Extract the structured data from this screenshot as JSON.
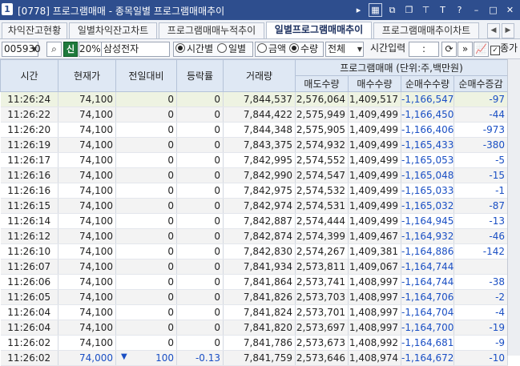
{
  "window": {
    "number": "1",
    "title": "[0778] 프로그램매매 - 종목일별 프로그램매매추이"
  },
  "titlebar_icons": [
    "caret-right-icon",
    "grid-icon",
    "copy-icon",
    "window-icon",
    "pin-icon",
    "font-icon",
    "help-icon",
    "minimize-icon",
    "restore-icon",
    "close-icon"
  ],
  "tabs": [
    {
      "label": "차익잔고현황",
      "active": false
    },
    {
      "label": "일별차익잔고차트",
      "active": false
    },
    {
      "label": "프로그램매매누적추이",
      "active": false
    },
    {
      "label": "일별프로그램매매추이",
      "active": true
    },
    {
      "label": "프로그램매매추이차트",
      "active": false
    }
  ],
  "toolbar": {
    "code": "005930",
    "badge": "신",
    "margin": "20%",
    "stock_name": "삼성전자",
    "period_options": [
      {
        "label": "시간별",
        "selected": true
      },
      {
        "label": "일별",
        "selected": false
      }
    ],
    "unit_options": [
      {
        "label": "금액",
        "selected": false
      },
      {
        "label": "수량",
        "selected": true
      }
    ],
    "scope": "전체",
    "time_label": "시간입력",
    "time_value": ":",
    "include_label": "종가",
    "include_checked": true
  },
  "grid": {
    "headers": {
      "time": "시간",
      "price": "현재가",
      "change": "전일대비",
      "rate": "등락률",
      "volume": "거래량",
      "program_group": "프로그램매매 (단위:주,백만원)",
      "sell": "매도수량",
      "buy": "매수수량",
      "net": "순매수수량",
      "net_delta": "순매수증감"
    },
    "rows": [
      {
        "time": "11:26:24",
        "price": "74,100",
        "change": "0",
        "rate": "0",
        "volume": "7,844,537",
        "sell": "2,576,064",
        "buy": "1,409,517",
        "net": "-1,166,547",
        "delta": "-97"
      },
      {
        "time": "11:26:22",
        "price": "74,100",
        "change": "0",
        "rate": "0",
        "volume": "7,844,422",
        "sell": "2,575,949",
        "buy": "1,409,499",
        "net": "-1,166,450",
        "delta": "-44"
      },
      {
        "time": "11:26:20",
        "price": "74,100",
        "change": "0",
        "rate": "0",
        "volume": "7,844,348",
        "sell": "2,575,905",
        "buy": "1,409,499",
        "net": "-1,166,406",
        "delta": "-973"
      },
      {
        "time": "11:26:19",
        "price": "74,100",
        "change": "0",
        "rate": "0",
        "volume": "7,843,375",
        "sell": "2,574,932",
        "buy": "1,409,499",
        "net": "-1,165,433",
        "delta": "-380"
      },
      {
        "time": "11:26:17",
        "price": "74,100",
        "change": "0",
        "rate": "0",
        "volume": "7,842,995",
        "sell": "2,574,552",
        "buy": "1,409,499",
        "net": "-1,165,053",
        "delta": "-5"
      },
      {
        "time": "11:26:16",
        "price": "74,100",
        "change": "0",
        "rate": "0",
        "volume": "7,842,990",
        "sell": "2,574,547",
        "buy": "1,409,499",
        "net": "-1,165,048",
        "delta": "-15"
      },
      {
        "time": "11:26:16",
        "price": "74,100",
        "change": "0",
        "rate": "0",
        "volume": "7,842,975",
        "sell": "2,574,532",
        "buy": "1,409,499",
        "net": "-1,165,033",
        "delta": "-1"
      },
      {
        "time": "11:26:15",
        "price": "74,100",
        "change": "0",
        "rate": "0",
        "volume": "7,842,974",
        "sell": "2,574,531",
        "buy": "1,409,499",
        "net": "-1,165,032",
        "delta": "-87"
      },
      {
        "time": "11:26:14",
        "price": "74,100",
        "change": "0",
        "rate": "0",
        "volume": "7,842,887",
        "sell": "2,574,444",
        "buy": "1,409,499",
        "net": "-1,164,945",
        "delta": "-13"
      },
      {
        "time": "11:26:12",
        "price": "74,100",
        "change": "0",
        "rate": "0",
        "volume": "7,842,874",
        "sell": "2,574,399",
        "buy": "1,409,467",
        "net": "-1,164,932",
        "delta": "-46"
      },
      {
        "time": "11:26:10",
        "price": "74,100",
        "change": "0",
        "rate": "0",
        "volume": "7,842,830",
        "sell": "2,574,267",
        "buy": "1,409,381",
        "net": "-1,164,886",
        "delta": "-142"
      },
      {
        "time": "11:26:07",
        "price": "74,100",
        "change": "0",
        "rate": "0",
        "volume": "7,841,934",
        "sell": "2,573,811",
        "buy": "1,409,067",
        "net": "-1,164,744",
        "delta": ""
      },
      {
        "time": "11:26:06",
        "price": "74,100",
        "change": "0",
        "rate": "0",
        "volume": "7,841,864",
        "sell": "2,573,741",
        "buy": "1,408,997",
        "net": "-1,164,744",
        "delta": "-38"
      },
      {
        "time": "11:26:05",
        "price": "74,100",
        "change": "0",
        "rate": "0",
        "volume": "7,841,826",
        "sell": "2,573,703",
        "buy": "1,408,997",
        "net": "-1,164,706",
        "delta": "-2"
      },
      {
        "time": "11:26:04",
        "price": "74,100",
        "change": "0",
        "rate": "0",
        "volume": "7,841,824",
        "sell": "2,573,701",
        "buy": "1,408,997",
        "net": "-1,164,704",
        "delta": "-4"
      },
      {
        "time": "11:26:04",
        "price": "74,100",
        "change": "0",
        "rate": "0",
        "volume": "7,841,820",
        "sell": "2,573,697",
        "buy": "1,408,997",
        "net": "-1,164,700",
        "delta": "-19"
      },
      {
        "time": "11:26:02",
        "price": "74,100",
        "change": "0",
        "rate": "0",
        "volume": "7,841,786",
        "sell": "2,573,673",
        "buy": "1,408,992",
        "net": "-1,164,681",
        "delta": "-9"
      },
      {
        "time": "11:26:02",
        "price": "74,000",
        "change": "100",
        "rate": "-0.13",
        "volume": "7,841,759",
        "sell": "2,573,646",
        "buy": "1,408,974",
        "net": "-1,164,672",
        "delta": "-10",
        "down": true
      }
    ]
  },
  "colors": {
    "titlebar": "#2e4e8e",
    "header": "#dfe8f4",
    "negative": "#1a4fc4",
    "positive": "#d02020",
    "badge": "#1e7a3c"
  }
}
